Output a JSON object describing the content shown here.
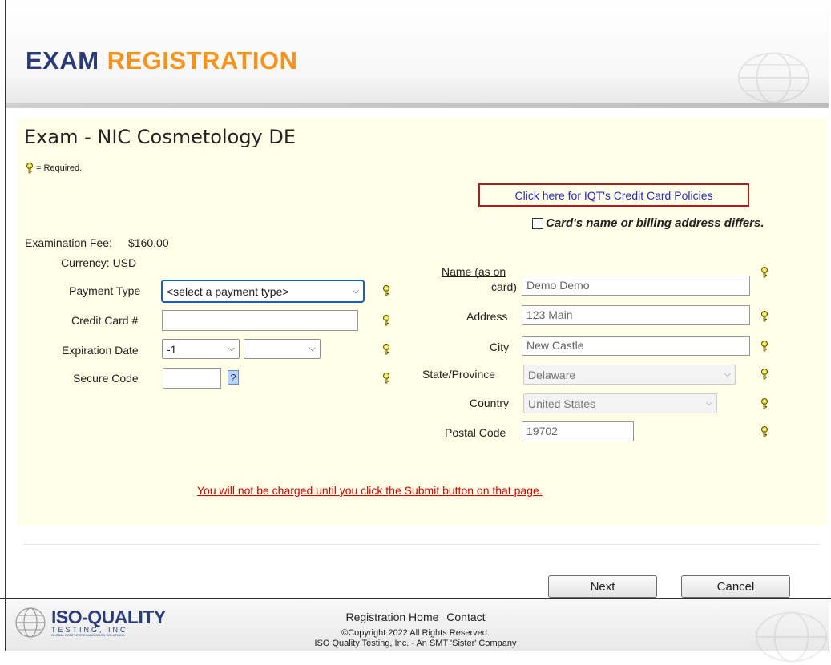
{
  "header": {
    "title_part1": "EXAM",
    "title_part2": "REGISTRATION"
  },
  "page": {
    "title": "Exam - NIC Cosmetology DE",
    "required_note": "= Required.",
    "cc_policy_link": "Click here for IQT's Credit Card Policies",
    "differs_label": "Card's name or billing address differs."
  },
  "payment": {
    "fee_label": "Examination Fee:",
    "fee_value": "$160.00",
    "currency_label": "Currency: USD",
    "payment_type_label": "Payment Type",
    "payment_type_value": "<select a payment type>",
    "credit_card_label": "Credit Card #",
    "credit_card_value": "",
    "expiration_label": "Expiration Date",
    "expiration_month": "-1",
    "expiration_year": "",
    "secure_code_label": "Secure Code",
    "secure_code_value": "",
    "help_glyph": "?"
  },
  "billing": {
    "name_label_line1": "Name (as on",
    "name_label_line2": "card)",
    "name_value": "Demo Demo",
    "address_label": "Address",
    "address_value": "123 Main",
    "city_label": "City",
    "city_value": "New Castle",
    "state_label": "State/Province",
    "state_value": "Delaware",
    "country_label": "Country",
    "country_value": "United States",
    "postal_label": "Postal Code",
    "postal_value": "19702"
  },
  "notice": "You will not be charged until you click the Submit button on that page.",
  "buttons": {
    "next": "Next",
    "cancel": "Cancel"
  },
  "footer": {
    "logo_name": "ISO-QUALITY",
    "logo_sub": "TESTING, INC",
    "logo_tagline": "GLOBAL COMPLETE EXAMINATION SOLUTIONS",
    "link_home": "Registration Home",
    "link_contact": "Contact",
    "copyright_line1": "©Copyright 2022 All Rights Reserved.",
    "copyright_line2": "ISO Quality Testing, Inc. - An SMT 'Sister' Company"
  },
  "colors": {
    "brand_navy": "#2a3b78",
    "brand_orange": "#f5941d",
    "link_blue": "#2a2ac7",
    "notice_red": "#d40000",
    "highlight_red": "#a51f24",
    "content_bg": "#ffffe8"
  },
  "icons": [
    "key-icon",
    "globe-icon",
    "checkbox-icon",
    "chevron-down-icon",
    "help-icon"
  ]
}
